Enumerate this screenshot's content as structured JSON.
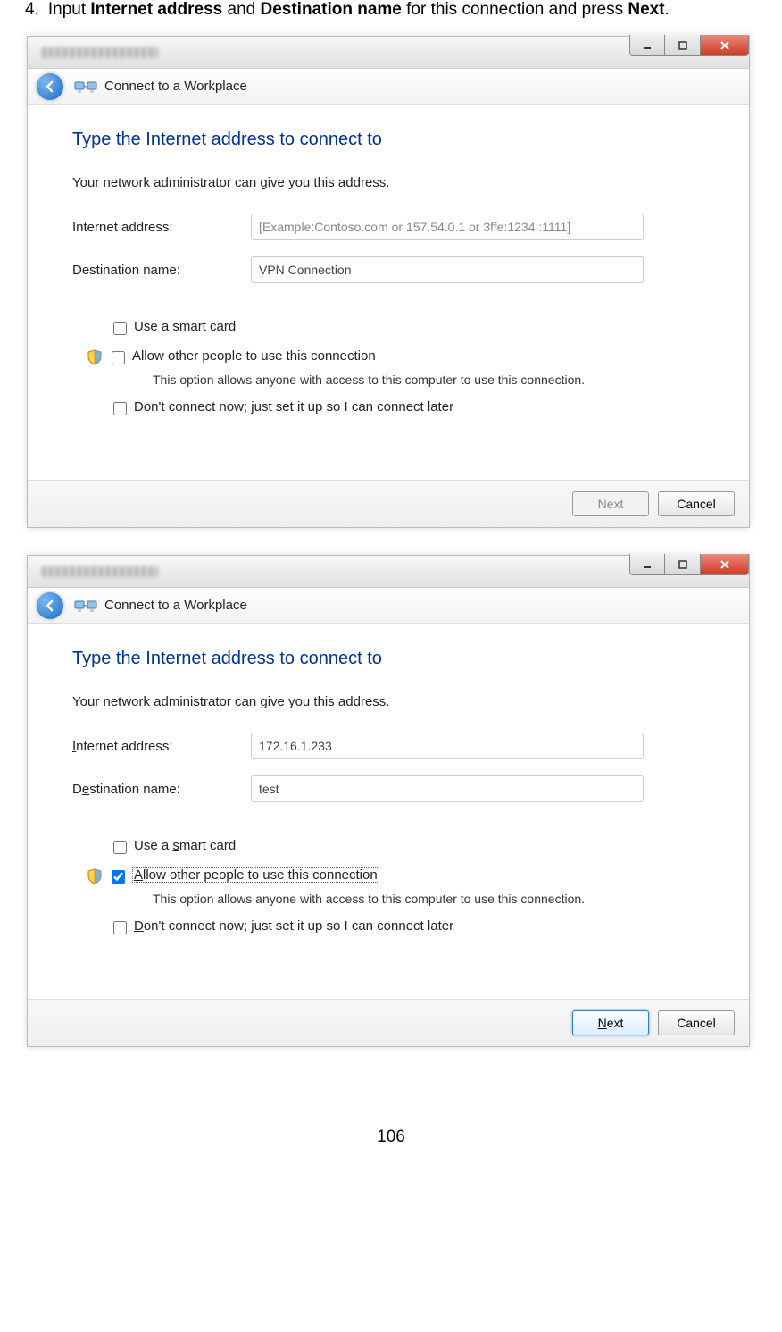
{
  "instruction": {
    "number": "4.",
    "text_a": "Input ",
    "bold_a": "Internet address",
    "text_b": " and ",
    "bold_b": "Destination name",
    "text_c": " for this connection and press ",
    "bold_c": "Next",
    "text_d": "."
  },
  "wizard1": {
    "subheader": "Connect to a Workplace",
    "heading": "Type the Internet address to connect to",
    "subtext": "Your network administrator can give you this address.",
    "label_internet": "Internet address:",
    "label_dest": "Destination name:",
    "internet_value": "",
    "internet_placeholder": "[Example:Contoso.com or 157.54.0.1 or 3ffe:1234::1111]",
    "dest_value": "VPN Connection",
    "opt_smartcard": "Use a smart card",
    "opt_allow": "Allow other people to use this connection",
    "opt_allow_desc": "This option allows anyone with access to this computer to use this connection.",
    "opt_dont": "Don't connect now; just set it up so I can connect later",
    "btn_next": "Next",
    "btn_cancel": "Cancel"
  },
  "wizard2": {
    "subheader": "Connect to a Workplace",
    "heading": "Type the Internet address to connect to",
    "subtext": "Your network administrator can give you this address.",
    "label_internet_pre": "I",
    "label_internet_post": "nternet address:",
    "label_dest_pre": "D",
    "label_dest_post": "e",
    "label_dest_rest": "stination name:",
    "internet_value": "172.16.1.233",
    "dest_value": "test",
    "opt_smartcard_pre": "Use a ",
    "opt_smartcard_u": "s",
    "opt_smartcard_post": "mart card",
    "opt_allow_u": "A",
    "opt_allow_post": "llow other people to use this connection",
    "opt_allow_desc": "This option allows anyone with access to this computer to use this connection.",
    "opt_dont_u": "D",
    "opt_dont_post": "on't connect now; just set it up so I can connect later",
    "btn_next_u": "N",
    "btn_next_post": "ext",
    "btn_cancel": "Cancel"
  },
  "page_number": "106"
}
